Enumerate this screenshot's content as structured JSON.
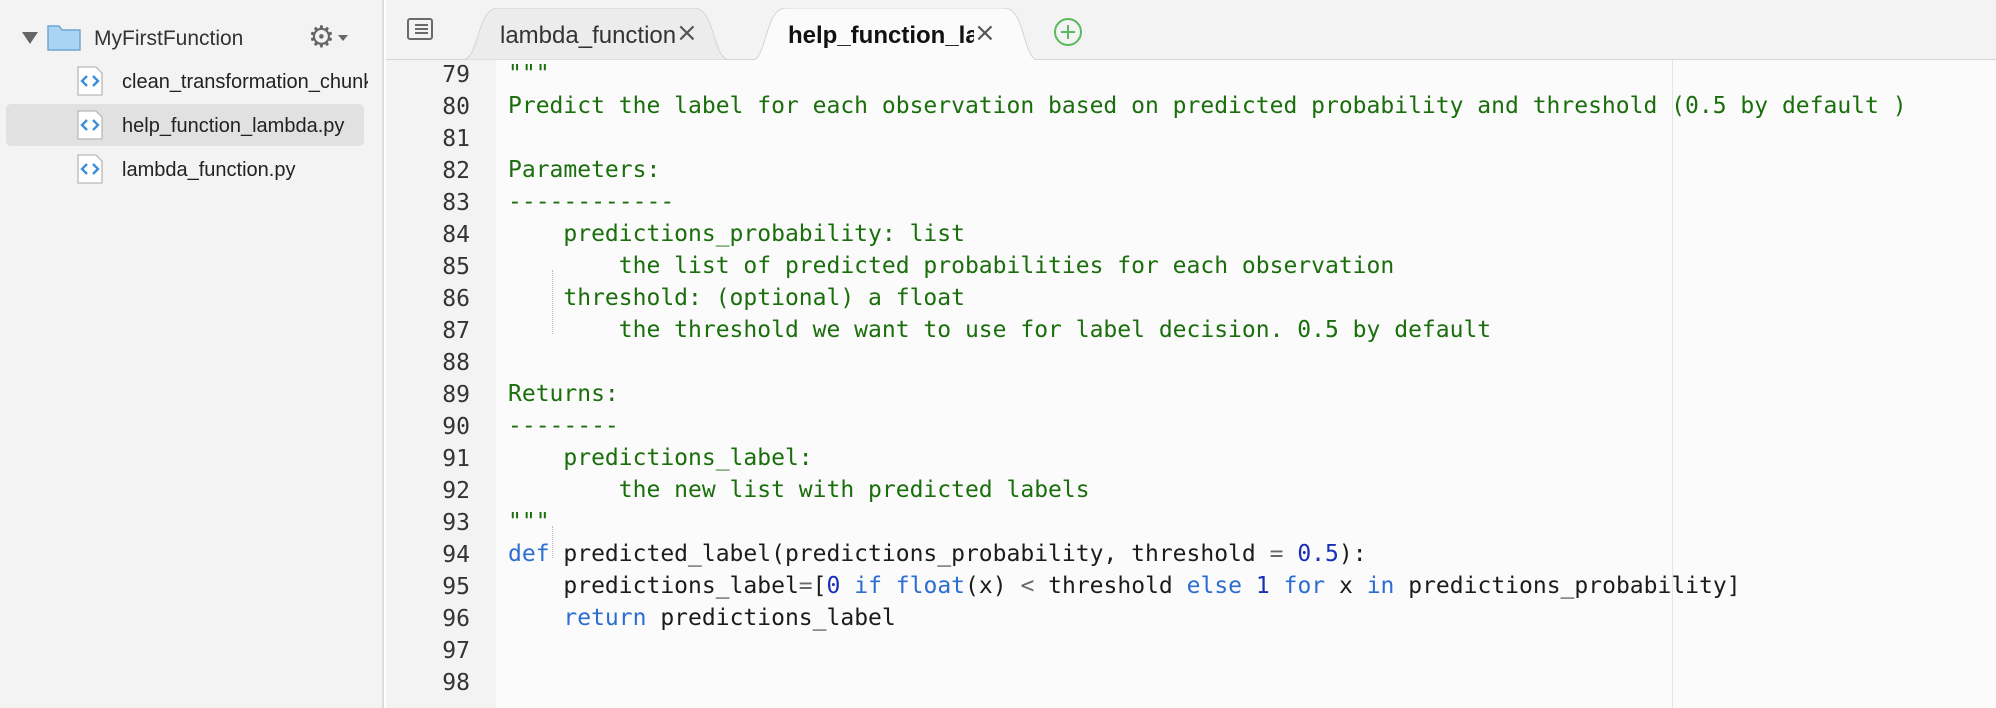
{
  "sidebar": {
    "root_label": "MyFirstFunction",
    "folder_icon": "folder-icon",
    "settings_icon": "gear-icon",
    "files": [
      {
        "label": "clean_transformation_chunk.py",
        "icon": "python-file-icon"
      },
      {
        "label": "help_function_lambda.py",
        "icon": "python-file-icon",
        "selected": true
      },
      {
        "label": "lambda_function.py",
        "icon": "python-file-icon"
      }
    ]
  },
  "tabs": [
    {
      "label": "lambda_function.py",
      "active": false,
      "close": "×"
    },
    {
      "label": "help_function_lambda.py",
      "active": true,
      "close": "×"
    }
  ],
  "editor": {
    "line_numbers": [
      "79",
      "80",
      "81",
      "82",
      "83",
      "84",
      "85",
      "86",
      "87",
      "88",
      "89",
      "90",
      "91",
      "92",
      "93",
      "94",
      "95",
      "96",
      "97",
      "98"
    ],
    "lines": [
      {
        "t": "str",
        "text": "\"\"\""
      },
      {
        "t": "str",
        "text": "Predict the label for each observation based on predicted probability and threshold (0.5 by default )"
      },
      {
        "t": "str",
        "text": ""
      },
      {
        "t": "str",
        "text": "Parameters:"
      },
      {
        "t": "str",
        "text": "------------"
      },
      {
        "t": "str",
        "text": "    predictions_probability: list"
      },
      {
        "t": "str",
        "text": "        the list of predicted probabilities for each observation"
      },
      {
        "t": "str",
        "text": "    threshold: (optional) a float"
      },
      {
        "t": "str",
        "text": "        the threshold we want to use for label decision. 0.5 by default"
      },
      {
        "t": "str",
        "text": ""
      },
      {
        "t": "str",
        "text": "Returns:"
      },
      {
        "t": "str",
        "text": "--------"
      },
      {
        "t": "str",
        "text": "    predictions_label:"
      },
      {
        "t": "str",
        "text": "        the new list with predicted labels"
      },
      {
        "t": "str",
        "text": "\"\"\""
      },
      {
        "t": "code",
        "tokens": [
          {
            "c": "kw",
            "s": "def"
          },
          {
            "c": "fn",
            "s": " predicted_label(predictions_probability, threshold "
          },
          {
            "c": "op",
            "s": "="
          },
          {
            "c": "fn",
            "s": " "
          },
          {
            "c": "num",
            "s": "0.5"
          },
          {
            "c": "fn",
            "s": "):"
          }
        ]
      },
      {
        "t": "code",
        "tokens": [
          {
            "c": "fn",
            "s": "    predictions_label"
          },
          {
            "c": "op",
            "s": "="
          },
          {
            "c": "fn",
            "s": "["
          },
          {
            "c": "num",
            "s": "0"
          },
          {
            "c": "fn",
            "s": " "
          },
          {
            "c": "kw",
            "s": "if"
          },
          {
            "c": "fn",
            "s": " "
          },
          {
            "c": "kw",
            "s": "float"
          },
          {
            "c": "fn",
            "s": "(x) "
          },
          {
            "c": "op",
            "s": "<"
          },
          {
            "c": "fn",
            "s": " threshold "
          },
          {
            "c": "kw",
            "s": "else"
          },
          {
            "c": "fn",
            "s": " "
          },
          {
            "c": "num",
            "s": "1"
          },
          {
            "c": "fn",
            "s": " "
          },
          {
            "c": "kw",
            "s": "for"
          },
          {
            "c": "fn",
            "s": " x "
          },
          {
            "c": "kw",
            "s": "in"
          },
          {
            "c": "fn",
            "s": " predictions_probability]"
          }
        ]
      },
      {
        "t": "code",
        "tokens": [
          {
            "c": "fn",
            "s": "    "
          },
          {
            "c": "kw",
            "s": "return"
          },
          {
            "c": "fn",
            "s": " predictions_label"
          }
        ]
      },
      {
        "t": "str",
        "text": ""
      },
      {
        "t": "str",
        "text": ""
      }
    ]
  },
  "colors": {
    "string": "#1a6e0c",
    "keyword": "#2b6ed0",
    "number": "#1a2fb8",
    "add_tab": "#5cb85c"
  }
}
